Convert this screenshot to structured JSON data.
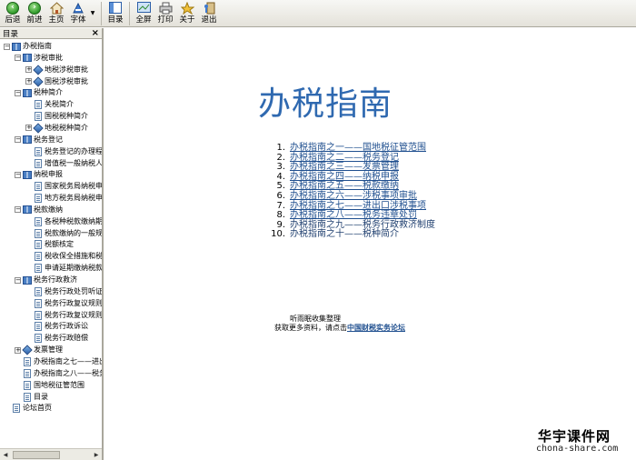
{
  "toolbar": {
    "back": "后退",
    "forward": "前进",
    "home": "主页",
    "font": "字体",
    "toc": "目录",
    "fullscreen": "全屏",
    "print": "打印",
    "about": "关于",
    "exit": "退出"
  },
  "pane": {
    "title": "目录",
    "close": "×"
  },
  "tree": [
    {
      "label": "办税指南",
      "indent": 0,
      "toggle": "−",
      "icon": "book"
    },
    {
      "label": "涉税审批",
      "indent": 1,
      "toggle": "−",
      "icon": "book"
    },
    {
      "label": "地税涉税审批",
      "indent": 2,
      "toggle": "+",
      "icon": "diamond"
    },
    {
      "label": "国税涉税审批",
      "indent": 2,
      "toggle": "+",
      "icon": "diamond"
    },
    {
      "label": "税种简介",
      "indent": 1,
      "toggle": "−",
      "icon": "book"
    },
    {
      "label": "关税简介",
      "indent": 2,
      "toggle": "",
      "icon": "page"
    },
    {
      "label": "国税税种简介",
      "indent": 2,
      "toggle": "",
      "icon": "page"
    },
    {
      "label": "地税税种简介",
      "indent": 2,
      "toggle": "+",
      "icon": "diamond"
    },
    {
      "label": "税务登记",
      "indent": 1,
      "toggle": "−",
      "icon": "book"
    },
    {
      "label": "税务登记的办理程",
      "indent": 2,
      "toggle": "",
      "icon": "page"
    },
    {
      "label": "增值税一般纳税人",
      "indent": 2,
      "toggle": "",
      "icon": "page"
    },
    {
      "label": "纳税申报",
      "indent": 1,
      "toggle": "−",
      "icon": "book"
    },
    {
      "label": "国家税务局纳税申",
      "indent": 2,
      "toggle": "",
      "icon": "page"
    },
    {
      "label": "地方税务局纳税申",
      "indent": 2,
      "toggle": "",
      "icon": "page"
    },
    {
      "label": "税款缴纳",
      "indent": 1,
      "toggle": "−",
      "icon": "book"
    },
    {
      "label": "各税种税款缴纳期",
      "indent": 2,
      "toggle": "",
      "icon": "page"
    },
    {
      "label": "税款缴纳的一般规",
      "indent": 2,
      "toggle": "",
      "icon": "page"
    },
    {
      "label": "税额核定",
      "indent": 2,
      "toggle": "",
      "icon": "page"
    },
    {
      "label": "税收保全措施和税",
      "indent": 2,
      "toggle": "",
      "icon": "page"
    },
    {
      "label": "申请延期缴纳税款",
      "indent": 2,
      "toggle": "",
      "icon": "page"
    },
    {
      "label": "税务行政救济",
      "indent": 1,
      "toggle": "−",
      "icon": "book"
    },
    {
      "label": "税务行政处罚听证",
      "indent": 2,
      "toggle": "",
      "icon": "page"
    },
    {
      "label": "税务行政复议规则",
      "indent": 2,
      "toggle": "",
      "icon": "page"
    },
    {
      "label": "税务行政复议规则",
      "indent": 2,
      "toggle": "",
      "icon": "page"
    },
    {
      "label": "税务行政诉讼",
      "indent": 2,
      "toggle": "",
      "icon": "page"
    },
    {
      "label": "税务行政赔偿",
      "indent": 2,
      "toggle": "",
      "icon": "page"
    },
    {
      "label": "发票管理",
      "indent": 1,
      "toggle": "+",
      "icon": "diamond"
    },
    {
      "label": "办税指南之七——进出",
      "indent": 1,
      "toggle": "",
      "icon": "page"
    },
    {
      "label": "办税指南之八——税务",
      "indent": 1,
      "toggle": "",
      "icon": "page"
    },
    {
      "label": "国地税征管范围",
      "indent": 1,
      "toggle": "",
      "icon": "page"
    },
    {
      "label": "目录",
      "indent": 1,
      "toggle": "",
      "icon": "page"
    },
    {
      "label": "论坛首页",
      "indent": 0,
      "toggle": "",
      "icon": "page"
    }
  ],
  "main": {
    "title": "办税指南",
    "toc": [
      {
        "n": "1.",
        "text": "办税指南之一——国地税征管范围",
        "link": true
      },
      {
        "n": "2.",
        "text": "办税指南之二——税务登记",
        "link": true
      },
      {
        "n": "3.",
        "text": "办税指南之三——发票管理",
        "link": true
      },
      {
        "n": "4.",
        "text": "办税指南之四——纳税申报",
        "link": true
      },
      {
        "n": "5.",
        "text": "办税指南之五——税款缴纳",
        "link": true
      },
      {
        "n": "6.",
        "text": "办税指南之六——涉税事项审批",
        "link": true
      },
      {
        "n": "7.",
        "text": "办税指南之七——进出口涉税事项",
        "link": true
      },
      {
        "n": "8.",
        "text": "办税指南之八——税务违章处罚",
        "link": true
      },
      {
        "n": "9.",
        "text": "办税指南之九——税务行政救济制度",
        "link": false
      },
      {
        "n": "10.",
        "text": "办税指南之十——税种简介",
        "link": false
      }
    ],
    "footer_line1": "听雨眠收集整理",
    "footer_line2": "获取更多资料，请点击",
    "footer_link": "中国财税实务论坛"
  },
  "watermark": {
    "cn": "华宇课件网",
    "url": "chona-share.com"
  }
}
